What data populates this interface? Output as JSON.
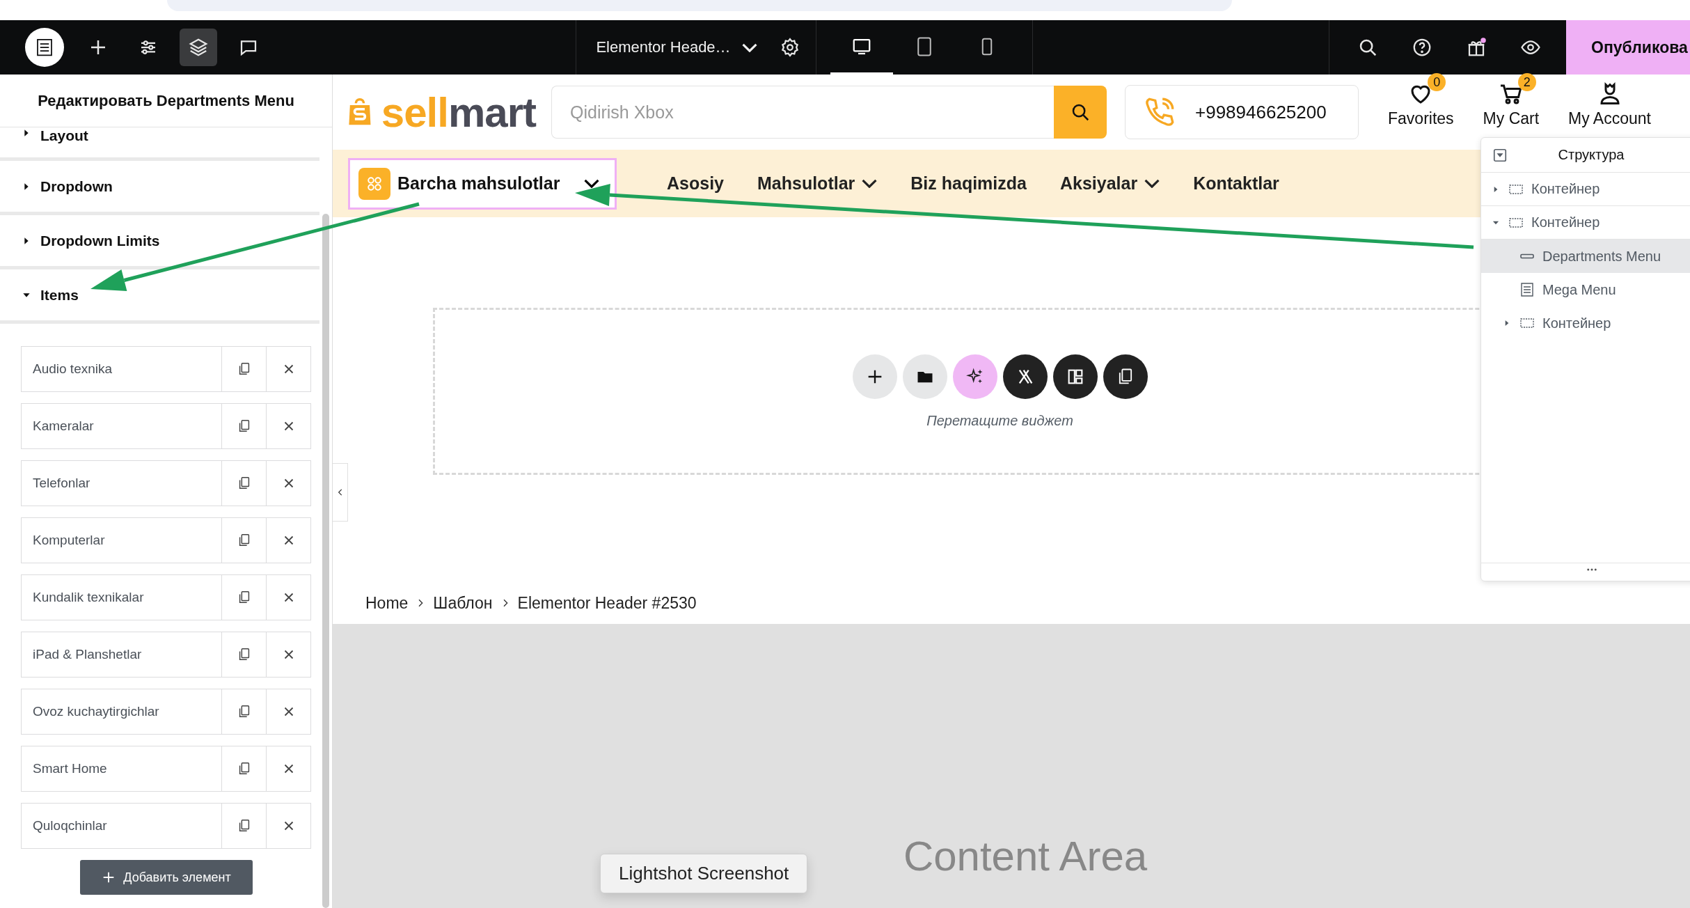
{
  "toolbar": {
    "tools": [
      {
        "kind": "add",
        "selected": false
      },
      {
        "kind": "settings",
        "selected": false
      },
      {
        "kind": "layers",
        "selected": true
      },
      {
        "kind": "comments",
        "selected": false
      }
    ],
    "document_title": "Elementor Heade…",
    "devices": [
      {
        "kind": "desktop",
        "selected": true
      },
      {
        "kind": "tablet",
        "selected": false
      },
      {
        "kind": "mobile",
        "selected": false
      }
    ],
    "publish_button": "Опубликова"
  },
  "panel": {
    "title": "Редактировать Departments Menu",
    "sections": [
      {
        "label": "Layout",
        "expanded": false
      },
      {
        "label": "Dropdown",
        "expanded": false
      },
      {
        "label": "Dropdown Limits",
        "expanded": false
      },
      {
        "label": "Items",
        "expanded": true
      }
    ],
    "items": [
      "Audio texnika",
      "Kameralar",
      "Telefonlar",
      "Komputerlar",
      "Kundalik texnikalar",
      "iPad & Planshetlar",
      "Ovoz kuchaytirgichlar",
      "Smart Home",
      "Quloqchinlar"
    ],
    "add_button": "Добавить элемент"
  },
  "site": {
    "logo_parts": [
      "sell",
      "mart"
    ],
    "search_placeholder": "Qidirish Xbox",
    "phone": "+998946625200",
    "favorites": {
      "label": "Favorites",
      "count": "0"
    },
    "cart": {
      "label": "My Cart",
      "count": "2"
    },
    "account": {
      "label": "My Account"
    },
    "departments": {
      "label": "Barcha mahsulotlar"
    },
    "nav": [
      {
        "label": "Asosiy",
        "dropdown": false
      },
      {
        "label": "Mahsulotlar",
        "dropdown": true
      },
      {
        "label": "Biz haqimizda",
        "dropdown": false
      },
      {
        "label": "Aksiyalar",
        "dropdown": true
      },
      {
        "label": "Kontaktlar",
        "dropdown": false
      }
    ]
  },
  "drop_zone": {
    "hint": "Перетащите виджет"
  },
  "breadcrumb": [
    "Home",
    "Шаблон",
    "Elementor Header #2530"
  ],
  "content_area": "Content Area",
  "structure": {
    "title": "Структура",
    "tree": [
      {
        "label": "Контейнер",
        "kind": "container",
        "expanded": false,
        "selected": false
      },
      {
        "label": "Контейнер",
        "kind": "container",
        "expanded": true,
        "selected": false,
        "children": [
          {
            "label": "Departments Menu",
            "kind": "menu",
            "selected": true
          },
          {
            "label": "Mega Menu",
            "kind": "mega",
            "selected": false
          },
          {
            "label": "Контейнер",
            "kind": "container",
            "expanded": false,
            "selected": false
          }
        ]
      }
    ]
  },
  "tooltip": "Lightshot Screenshot"
}
